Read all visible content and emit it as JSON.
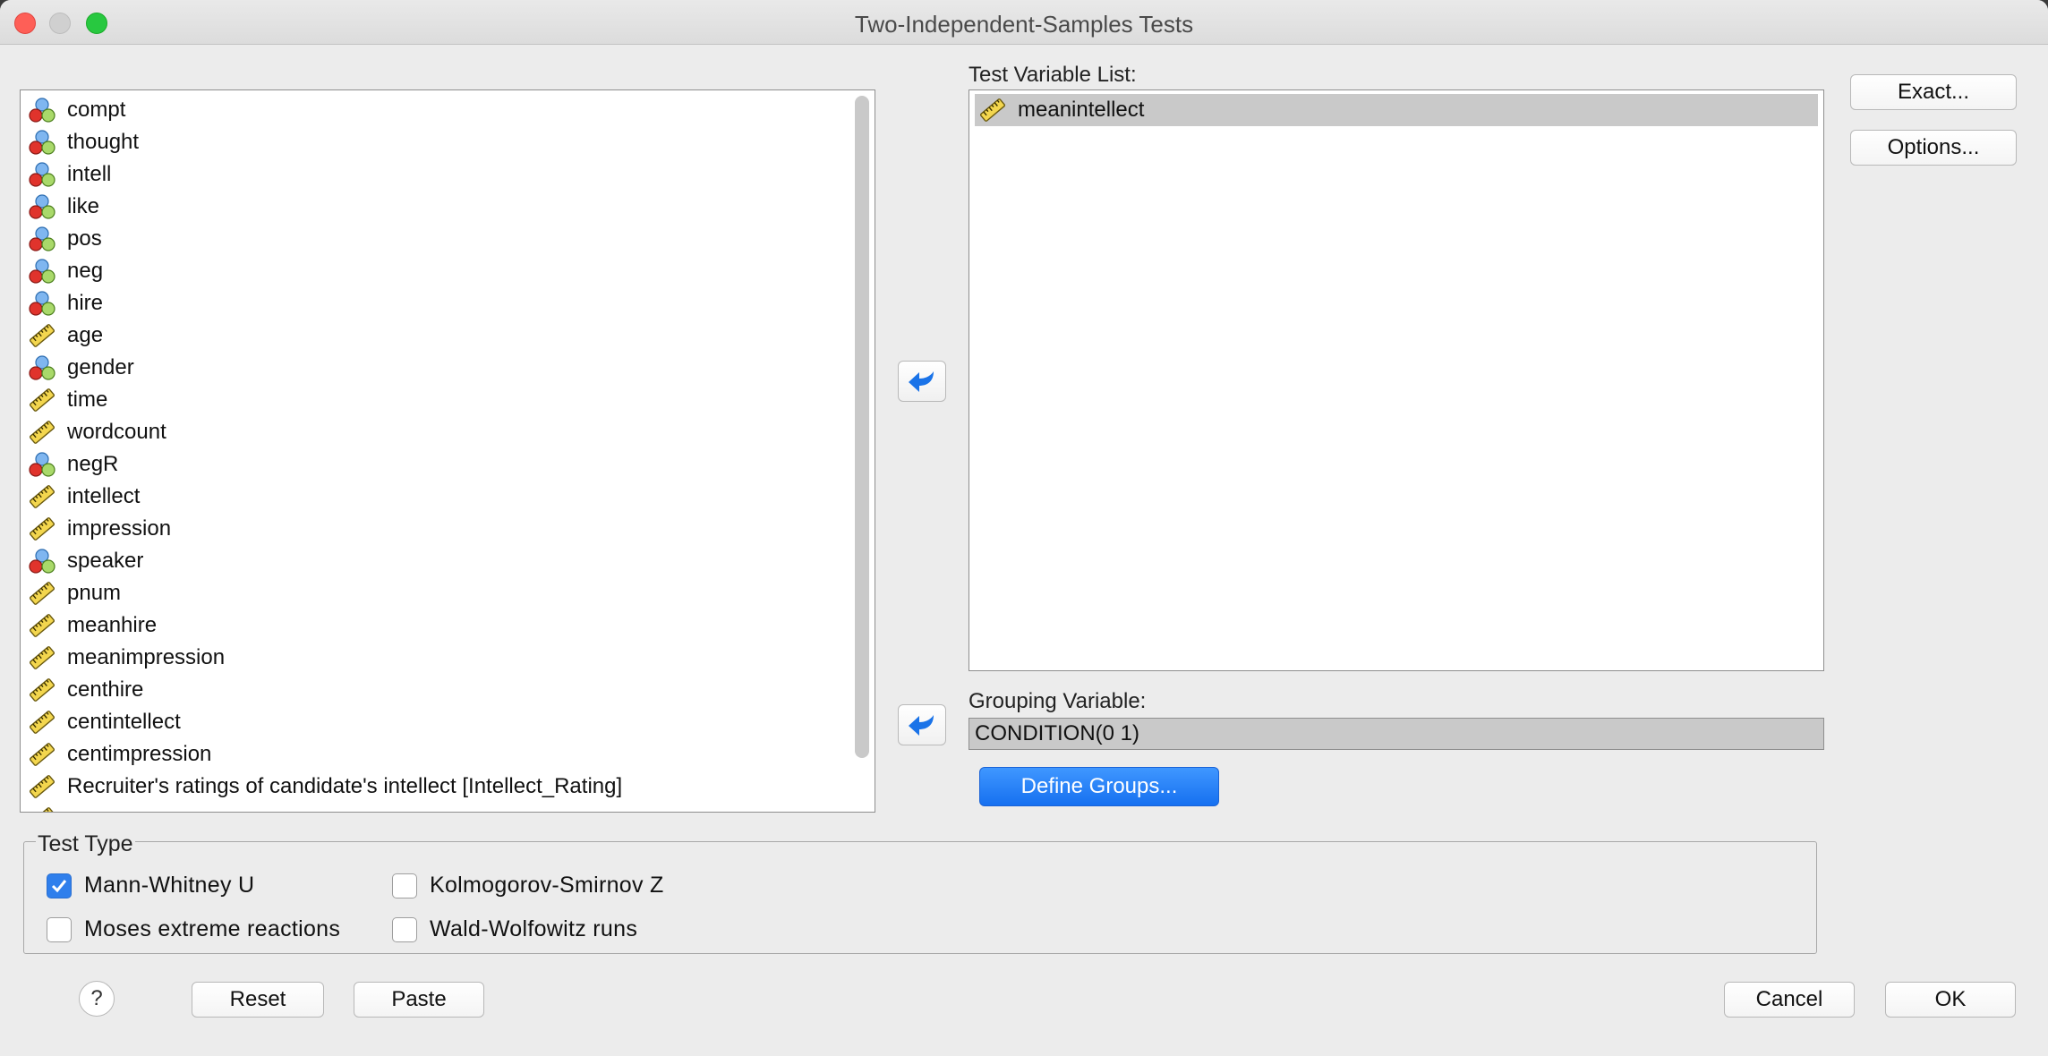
{
  "window": {
    "title": "Two-Independent-Samples Tests"
  },
  "variables": [
    {
      "label": "compt",
      "icon": "nominal-icon"
    },
    {
      "label": "thought",
      "icon": "nominal-icon"
    },
    {
      "label": "intell",
      "icon": "nominal-icon"
    },
    {
      "label": "like",
      "icon": "nominal-icon"
    },
    {
      "label": "pos",
      "icon": "nominal-icon"
    },
    {
      "label": "neg",
      "icon": "nominal-icon"
    },
    {
      "label": "hire",
      "icon": "nominal-icon"
    },
    {
      "label": "age",
      "icon": "scale-icon"
    },
    {
      "label": "gender",
      "icon": "nominal-icon"
    },
    {
      "label": "time",
      "icon": "scale-icon"
    },
    {
      "label": "wordcount",
      "icon": "scale-icon"
    },
    {
      "label": "negR",
      "icon": "nominal-icon"
    },
    {
      "label": "intellect",
      "icon": "scale-icon"
    },
    {
      "label": "impression",
      "icon": "scale-icon"
    },
    {
      "label": "speaker",
      "icon": "nominal-icon"
    },
    {
      "label": "pnum",
      "icon": "scale-icon"
    },
    {
      "label": "meanhire",
      "icon": "scale-icon"
    },
    {
      "label": "meanimpression",
      "icon": "scale-icon"
    },
    {
      "label": "centhire",
      "icon": "scale-icon"
    },
    {
      "label": "centintellect",
      "icon": "scale-icon"
    },
    {
      "label": "centimpression",
      "icon": "scale-icon"
    },
    {
      "label": "Recruiter's ratings of candidate's intellect [Intellect_Rating]",
      "icon": "scale-icon"
    },
    {
      "label": "",
      "icon": "scale-icon"
    }
  ],
  "test_variables": {
    "label": "Test Variable List:",
    "items": [
      {
        "label": "meanintellect",
        "icon": "scale-icon"
      }
    ]
  },
  "grouping": {
    "label": "Grouping Variable:",
    "value": "CONDITION(0 1)",
    "define_button": "Define Groups..."
  },
  "side_buttons": {
    "exact": "Exact...",
    "options": "Options..."
  },
  "test_type": {
    "legend": "Test Type",
    "options": [
      {
        "label": "Mann-Whitney U",
        "checked": true
      },
      {
        "label": "Kolmogorov-Smirnov Z",
        "checked": false
      },
      {
        "label": "Moses extreme reactions",
        "checked": false
      },
      {
        "label": "Wald-Wolfowitz runs",
        "checked": false
      }
    ]
  },
  "footer": {
    "help": "?",
    "reset": "Reset",
    "paste": "Paste",
    "cancel": "Cancel",
    "ok": "OK"
  },
  "colors": {
    "accent": "#1670f0",
    "selected_row": "#c9c9c9"
  }
}
